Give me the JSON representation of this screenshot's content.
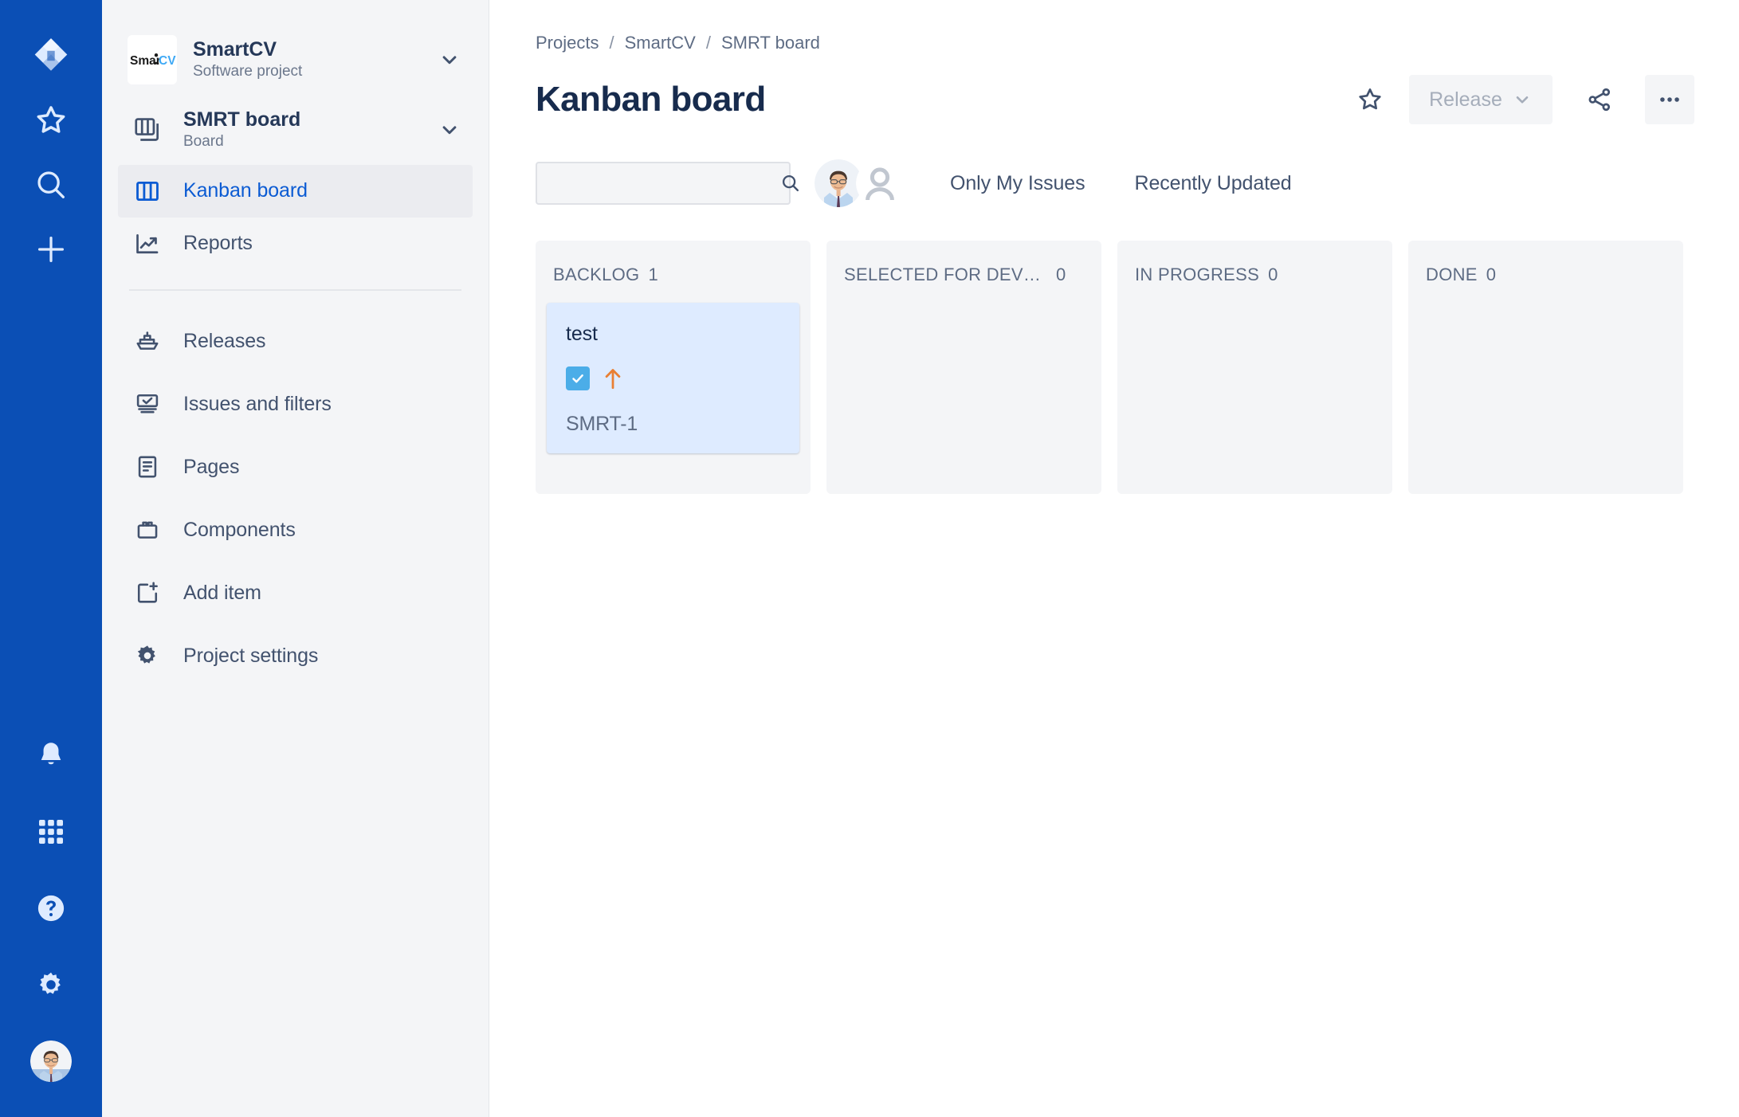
{
  "rail": {
    "top_items": [
      {
        "name": "jira-logo-icon",
        "label": "Jira"
      },
      {
        "name": "star-icon",
        "label": "Starred"
      },
      {
        "name": "search-icon",
        "label": "Search"
      },
      {
        "name": "plus-icon",
        "label": "Create"
      }
    ],
    "bottom_items": [
      {
        "name": "bell-icon",
        "label": "Notifications"
      },
      {
        "name": "apps-grid-icon",
        "label": "App switcher"
      },
      {
        "name": "help-icon",
        "label": "Help"
      },
      {
        "name": "settings-gear-icon",
        "label": "Settings"
      },
      {
        "name": "user-avatar",
        "label": "Your profile"
      }
    ],
    "background_color": "#0B4FB5"
  },
  "sidebar": {
    "project": {
      "logo_text_dark": "Smar",
      "logo_text_light": "CV",
      "name": "SmartCV",
      "type": "Software project"
    },
    "board": {
      "name": "SMRT board",
      "type": "Board"
    },
    "nav_primary": [
      {
        "label": "Kanban board",
        "icon": "board-columns-icon",
        "active": true
      },
      {
        "label": "Reports",
        "icon": "chart-trend-icon",
        "active": false
      }
    ],
    "nav_secondary": [
      {
        "label": "Releases",
        "icon": "ship-icon"
      },
      {
        "label": "Issues and filters",
        "icon": "issues-icon"
      },
      {
        "label": "Pages",
        "icon": "page-icon"
      },
      {
        "label": "Components",
        "icon": "components-icon"
      },
      {
        "label": "Add item",
        "icon": "add-item-icon"
      },
      {
        "label": "Project settings",
        "icon": "gear-icon"
      }
    ],
    "background_color": "#F4F5F7"
  },
  "header": {
    "breadcrumb": [
      "Projects",
      "SmartCV",
      "SMRT board"
    ],
    "breadcrumb_separator": "/",
    "page_title": "Kanban board",
    "star_icon": "star-outline-icon",
    "release_button": "Release",
    "share_icon": "share-icon",
    "more_icon": "more-ellipsis-icon"
  },
  "toolbar": {
    "search_placeholder": "",
    "search_value": "",
    "search_icon": "search-icon",
    "avatars": [
      {
        "name": "avatar-user-photo",
        "type": "photo"
      },
      {
        "name": "avatar-unassigned",
        "type": "placeholder"
      }
    ],
    "filters": [
      "Only My Issues",
      "Recently Updated"
    ]
  },
  "board": {
    "columns": [
      {
        "title": "BACKLOG",
        "count": "1",
        "cards": [
          {
            "title": "test",
            "key": "SMRT-1",
            "type_icon": "task-checkbox-icon",
            "priority_icon": "priority-high-arrow-icon",
            "priority_color": "#E97F33",
            "type_color": "#4BADE8",
            "background": "#DEEBFF"
          }
        ]
      },
      {
        "title": "SELECTED FOR DEVEL…",
        "count": "0",
        "cards": []
      },
      {
        "title": "IN PROGRESS",
        "count": "0",
        "cards": []
      },
      {
        "title": "DONE",
        "count": "0",
        "cards": []
      }
    ]
  }
}
